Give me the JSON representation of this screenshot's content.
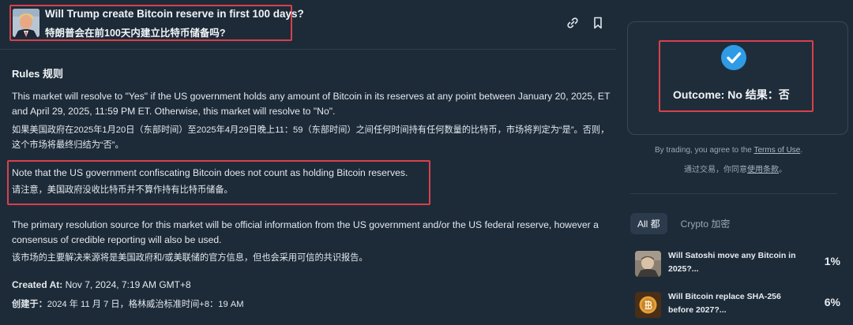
{
  "market": {
    "question_en": "Will Trump create Bitcoin reserve in first 100 days?",
    "question_zh": "特朗普会在前100天内建立比特币储备吗?"
  },
  "rules": {
    "heading": "Rules 规则",
    "para1_en": "This market will resolve to \"Yes\" if the US government holds any amount of Bitcoin in its reserves at any point between January 20, 2025, ET and April 29, 2025, 11:59 PM ET. Otherwise, this market will resolve to \"No\".",
    "para1_zh": "如果美国政府在2025年1月20日（东部时间）至2025年4月29日晚上11：59（东部时间）之间任何时间持有任何数量的比特币，市场将判定为“是”。否则，这个市场将最终归结为“否”。",
    "note_en": "Note that the US government confiscating Bitcoin does not count as holding Bitcoin reserves.",
    "note_zh": "请注意，美国政府没收比特币并不算作持有比特币储备。",
    "para3_en": "The primary resolution source for this market will be official information from the US government and/or the US federal reserve, however a consensus of credible reporting will also be used.",
    "para3_zh": "该市场的主要解决来源将是美国政府和/或美联储的官方信息，但也会采用可信的共识报告。",
    "created_label_en": "Created At:",
    "created_value_en": "Nov 7, 2024, 7:19 AM GMT+8",
    "created_label_zh": "创建于：",
    "created_value_zh": "2024 年 11 月 7 日，格林威治标准时间+8：19 AM"
  },
  "icons": {
    "link": "link-icon",
    "bookmark": "bookmark-icon",
    "check": "check-circle-icon"
  },
  "outcome": {
    "text": "Outcome: No  结果：否",
    "accent": "#2e9be6"
  },
  "terms": {
    "en_prefix": "By trading, you agree to the ",
    "en_link": "Terms of Use",
    "en_suffix": ".",
    "zh_prefix": "通过交易，你同意",
    "zh_link": "使用条款",
    "zh_suffix": "。"
  },
  "tabs": [
    {
      "label": "All 都",
      "active": true
    },
    {
      "label": "Crypto 加密",
      "active": false
    }
  ],
  "related": [
    {
      "title": "Will Satoshi move any Bitcoin in 2025?...",
      "pct": "1%"
    },
    {
      "title": "Will Bitcoin replace SHA-256 before 2027?...",
      "pct": "6%"
    }
  ],
  "colors": {
    "background": "#1d2b39",
    "highlight_border": "#d9404a"
  }
}
